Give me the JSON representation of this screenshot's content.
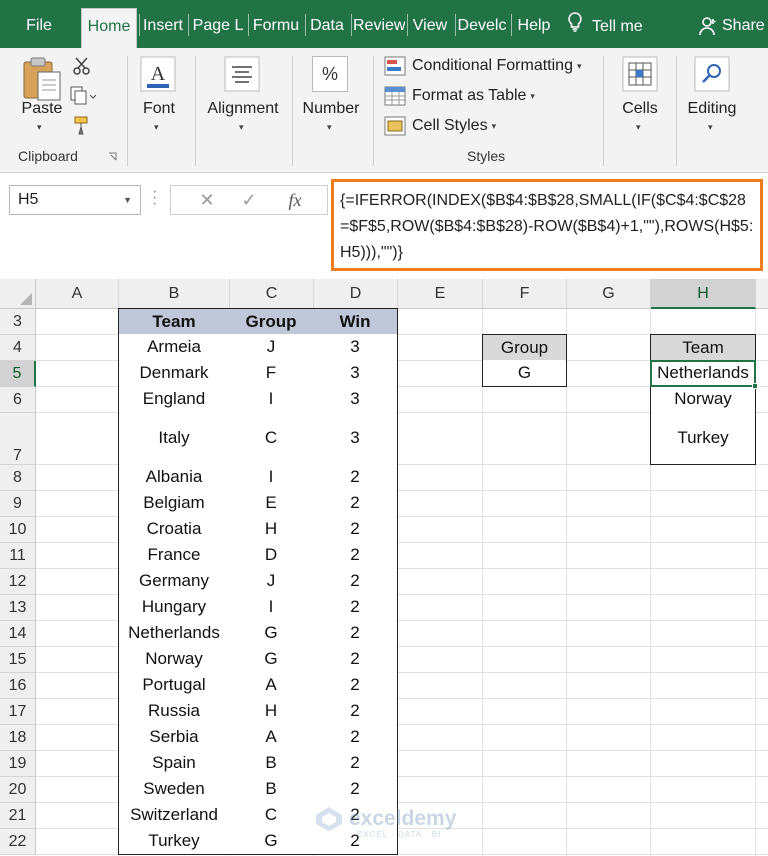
{
  "ribbon_tabs": [
    {
      "label": "File",
      "active": false
    },
    {
      "label": "Home",
      "active": true
    },
    {
      "label": "Insert",
      "active": false
    },
    {
      "label": "Page L",
      "active": false
    },
    {
      "label": "Formu",
      "active": false
    },
    {
      "label": "Data",
      "active": false
    },
    {
      "label": "Review",
      "active": false
    },
    {
      "label": "View",
      "active": false
    },
    {
      "label": "Develc",
      "active": false
    },
    {
      "label": "Help",
      "active": false
    }
  ],
  "tell_me": "Tell me",
  "share": "Share",
  "ribbon": {
    "clipboard": {
      "paste": "Paste",
      "group_label": "Clipboard"
    },
    "font": {
      "label": "Font"
    },
    "alignment": {
      "label": "Alignment"
    },
    "number": {
      "label": "Number",
      "icon_glyph": "%"
    },
    "styles": {
      "conditional_formatting": "Conditional Formatting",
      "format_as_table": "Format as Table",
      "cell_styles": "Cell Styles",
      "group_label": "Styles"
    },
    "cells": {
      "label": "Cells"
    },
    "editing": {
      "label": "Editing"
    }
  },
  "formula_bar": {
    "name_box": "H5",
    "cancel_glyph": "✕",
    "enter_glyph": "✓",
    "fx_glyph": "fx",
    "formula": "{=IFERROR(INDEX($B$4:$B$28,SMALL(IF($C$4:$C$28=$F$5,ROW($B$4:$B$28)-ROW($B$4)+1,\"\"),ROWS(H$5:H5))),\"\")}"
  },
  "columns": [
    "A",
    "B",
    "C",
    "D",
    "E",
    "F",
    "G",
    "H"
  ],
  "selected_column": "H",
  "rows": [
    "3",
    "4",
    "5",
    "6",
    "7",
    "8",
    "9",
    "10",
    "11",
    "12",
    "13",
    "14",
    "15",
    "16",
    "17",
    "18",
    "19",
    "20",
    "21",
    "22"
  ],
  "selected_row": "5",
  "main_table": {
    "headers": [
      "Team",
      "Group",
      "Win"
    ],
    "rows": [
      [
        "Armeia",
        "J",
        "3"
      ],
      [
        "Denmark",
        "F",
        "3"
      ],
      [
        "England",
        "I",
        "3"
      ],
      [
        "Italy",
        "C",
        "3"
      ],
      [
        "Albania",
        "I",
        "2"
      ],
      [
        "Belgiam",
        "E",
        "2"
      ],
      [
        "Croatia",
        "H",
        "2"
      ],
      [
        "France",
        "D",
        "2"
      ],
      [
        "Germany",
        "J",
        "2"
      ],
      [
        "Hungary",
        "I",
        "2"
      ],
      [
        "Netherlands",
        "G",
        "2"
      ],
      [
        "Norway",
        "G",
        "2"
      ],
      [
        "Portugal",
        "A",
        "2"
      ],
      [
        "Russia",
        "H",
        "2"
      ],
      [
        "Serbia",
        "A",
        "2"
      ],
      [
        "Spain",
        "B",
        "2"
      ],
      [
        "Sweden",
        "B",
        "2"
      ],
      [
        "Switzerland",
        "C",
        "2"
      ],
      [
        "Turkey",
        "G",
        "2"
      ]
    ]
  },
  "criteria_table": {
    "header": "Group",
    "value": "G"
  },
  "result_table": {
    "header": "Team",
    "values": [
      "Netherlands",
      "Norway",
      "Turkey"
    ]
  },
  "watermark": {
    "name": "exceldemy",
    "tagline": "EXCEL · DATA · BI"
  },
  "colors": {
    "excel_green": "#217346",
    "formula_highlight": "#f07d1f",
    "table_header": "#bfc7d8"
  }
}
